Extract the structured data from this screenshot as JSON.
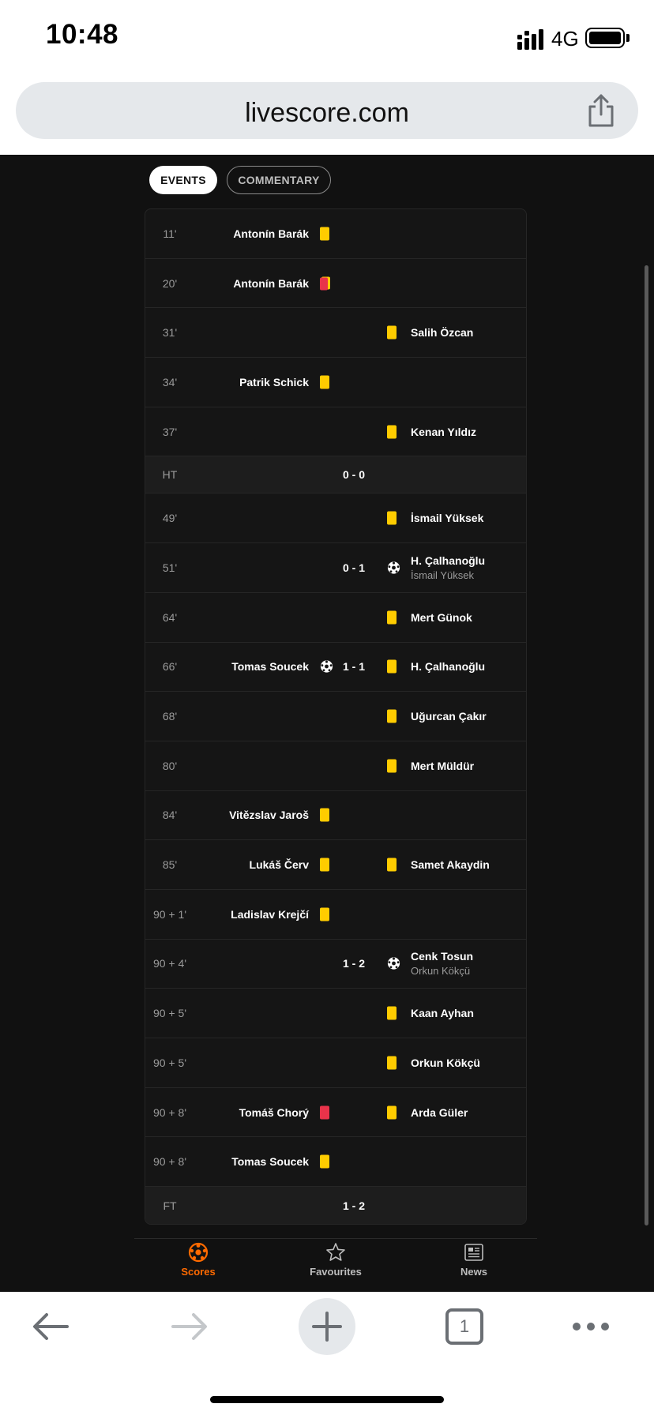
{
  "status_bar": {
    "time": "10:48",
    "network": "4G"
  },
  "browser": {
    "url": "livescore.com",
    "tab_count": "1"
  },
  "tabs": {
    "events": "EVENTS",
    "commentary": "COMMENTARY"
  },
  "colors": {
    "yellow_card": "#ffcc00",
    "red_card": "#e8334a",
    "accent": "#ff6a00"
  },
  "events": [
    {
      "minute": "11'",
      "home": "Antonín Barák",
      "home_icon": "yellow-card"
    },
    {
      "minute": "20'",
      "home": "Antonín Barák",
      "home_icon": "second-yellow-card"
    },
    {
      "minute": "31'",
      "away": "Salih Özcan",
      "away_icon": "yellow-card"
    },
    {
      "minute": "34'",
      "home": "Patrik Schick",
      "home_icon": "yellow-card"
    },
    {
      "minute": "37'",
      "away": "Kenan Yıldız",
      "away_icon": "yellow-card"
    },
    {
      "minute": "HT",
      "score": "0 - 0",
      "type": "period"
    },
    {
      "minute": "49'",
      "away": "İsmail Yüksek",
      "away_icon": "yellow-card"
    },
    {
      "minute": "51'",
      "score": "0 - 1",
      "away": "H. Çalhanoğlu",
      "away_assist": "İsmail Yüksek",
      "away_icon": "goal"
    },
    {
      "minute": "64'",
      "away": "Mert Günok",
      "away_icon": "yellow-card"
    },
    {
      "minute": "66'",
      "home": "Tomas Soucek",
      "home_icon": "goal",
      "score": "1 - 1",
      "away": "H. Çalhanoğlu",
      "away_icon": "yellow-card"
    },
    {
      "minute": "68'",
      "away": "Uğurcan Çakır",
      "away_icon": "yellow-card"
    },
    {
      "minute": "80'",
      "away": "Mert Müldür",
      "away_icon": "yellow-card"
    },
    {
      "minute": "84'",
      "home": "Vitězslav Jaroš",
      "home_icon": "yellow-card"
    },
    {
      "minute": "85'",
      "home": "Lukáš Červ",
      "home_icon": "yellow-card",
      "away": "Samet Akaydin",
      "away_icon": "yellow-card"
    },
    {
      "minute": "90 + 1'",
      "home": "Ladislav Krejčí",
      "home_icon": "yellow-card"
    },
    {
      "minute": "90 + 4'",
      "score": "1 - 2",
      "away": "Cenk Tosun",
      "away_assist": "Orkun Kökçü",
      "away_icon": "goal"
    },
    {
      "minute": "90 + 5'",
      "away": "Kaan Ayhan",
      "away_icon": "yellow-card"
    },
    {
      "minute": "90 + 5'",
      "away": "Orkun Kökçü",
      "away_icon": "yellow-card"
    },
    {
      "minute": "90 + 8'",
      "home": "Tomáš Chorý",
      "home_icon": "red-card",
      "away": "Arda Güler",
      "away_icon": "yellow-card"
    },
    {
      "minute": "90 + 8'",
      "home": "Tomas Soucek",
      "home_icon": "yellow-card"
    },
    {
      "minute": "FT",
      "score": "1 - 2",
      "type": "period"
    }
  ],
  "app_nav": [
    {
      "label": "Scores",
      "icon": "football-icon",
      "active": true
    },
    {
      "label": "Favourites",
      "icon": "star-icon",
      "active": false
    },
    {
      "label": "News",
      "icon": "news-icon",
      "active": false
    }
  ]
}
